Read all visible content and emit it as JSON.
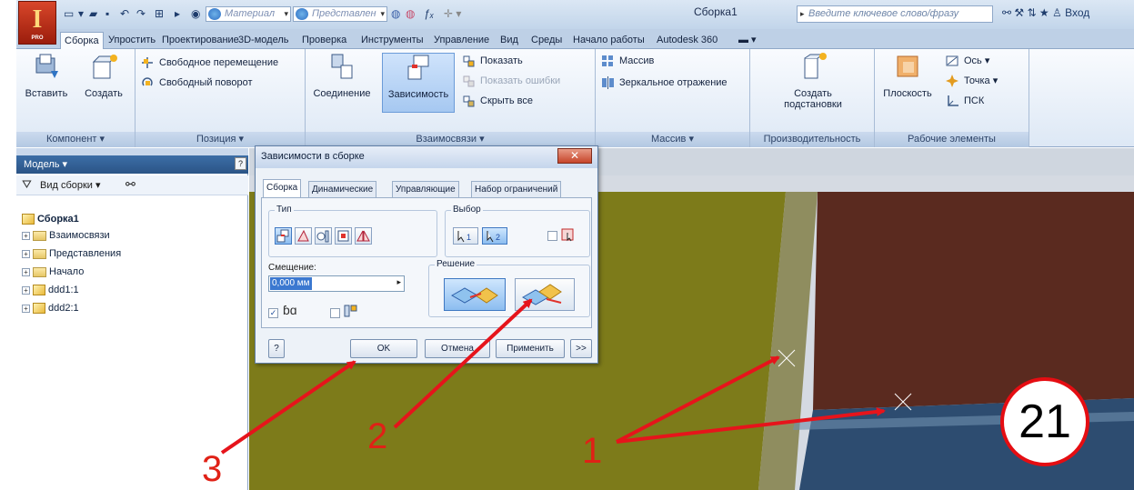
{
  "app": {
    "logo_letter": "I",
    "logo_sub": "PRO",
    "doc_title": "Сборка1",
    "qa_material": "Материал",
    "qa_view": "Представлен",
    "search_placeholder": "Введите ключевое слово/фразу",
    "signin": "Вход"
  },
  "tabs": [
    {
      "label": "Сборка",
      "active": true
    },
    {
      "label": "Упростить"
    },
    {
      "label": "Проектирование"
    },
    {
      "label": "3D-модель"
    },
    {
      "label": "Проверка"
    },
    {
      "label": "Инструменты"
    },
    {
      "label": "Управление"
    },
    {
      "label": "Вид"
    },
    {
      "label": "Среды"
    },
    {
      "label": "Начало работы"
    },
    {
      "label": "Autodesk 360"
    }
  ],
  "ribbon": {
    "component": {
      "insert": "Вставить",
      "create": "Создать",
      "title": "Компонент ▾"
    },
    "position": {
      "free_move": "Свободное перемещение",
      "free_rotate": "Свободный поворот",
      "title": "Позиция ▾"
    },
    "relations": {
      "joint": "Соединение",
      "constraint": "Зависимость",
      "show": "Показать",
      "show_errors": "Показать ошибки",
      "hide_all": "Скрыть все",
      "title": "Взаимосвязи ▾"
    },
    "pattern": {
      "pattern": "Массив",
      "mirror": "Зеркальное отражение",
      "title": "Массив ▾"
    },
    "productivity": {
      "create_sub": "Создать",
      "create_sub2": "подстановки",
      "title": "Производительность"
    },
    "workfeatures": {
      "plane": "Плоскость",
      "axis": "Ось ▾",
      "point": "Точка ▾",
      "ucs": "ПСК",
      "title": "Рабочие элементы"
    }
  },
  "panel": {
    "header": "Модель ▾",
    "view": "Вид сборки",
    "root": "Сборка1",
    "items": [
      "Взаимосвязи",
      "Представления",
      "Начало",
      "ddd1:1",
      "ddd2:1"
    ]
  },
  "dialog": {
    "title": "Зависимости в сборке",
    "close": "✕",
    "tabs": [
      "Сборка",
      "Динамические",
      "Управляющие",
      "Набор ограничений"
    ],
    "type_label": "Тип",
    "select_label": "Выбор",
    "offset_label": "Смещение:",
    "offset_value": "0,000 мм",
    "solution_label": "Решение",
    "ok": "OK",
    "cancel": "Отмена",
    "apply": "Применить",
    "more": ">>",
    "help": "?"
  },
  "annotations": {
    "step1": "1",
    "step2": "2",
    "step3": "3",
    "badge": "21"
  },
  "colors": {
    "arrow": "#e6141b",
    "ribbon_bg": "#e6eef8",
    "yellow_part": "#8c8a1e",
    "brown_part": "#5c2b1f",
    "blue_part": "#2d4f74"
  }
}
